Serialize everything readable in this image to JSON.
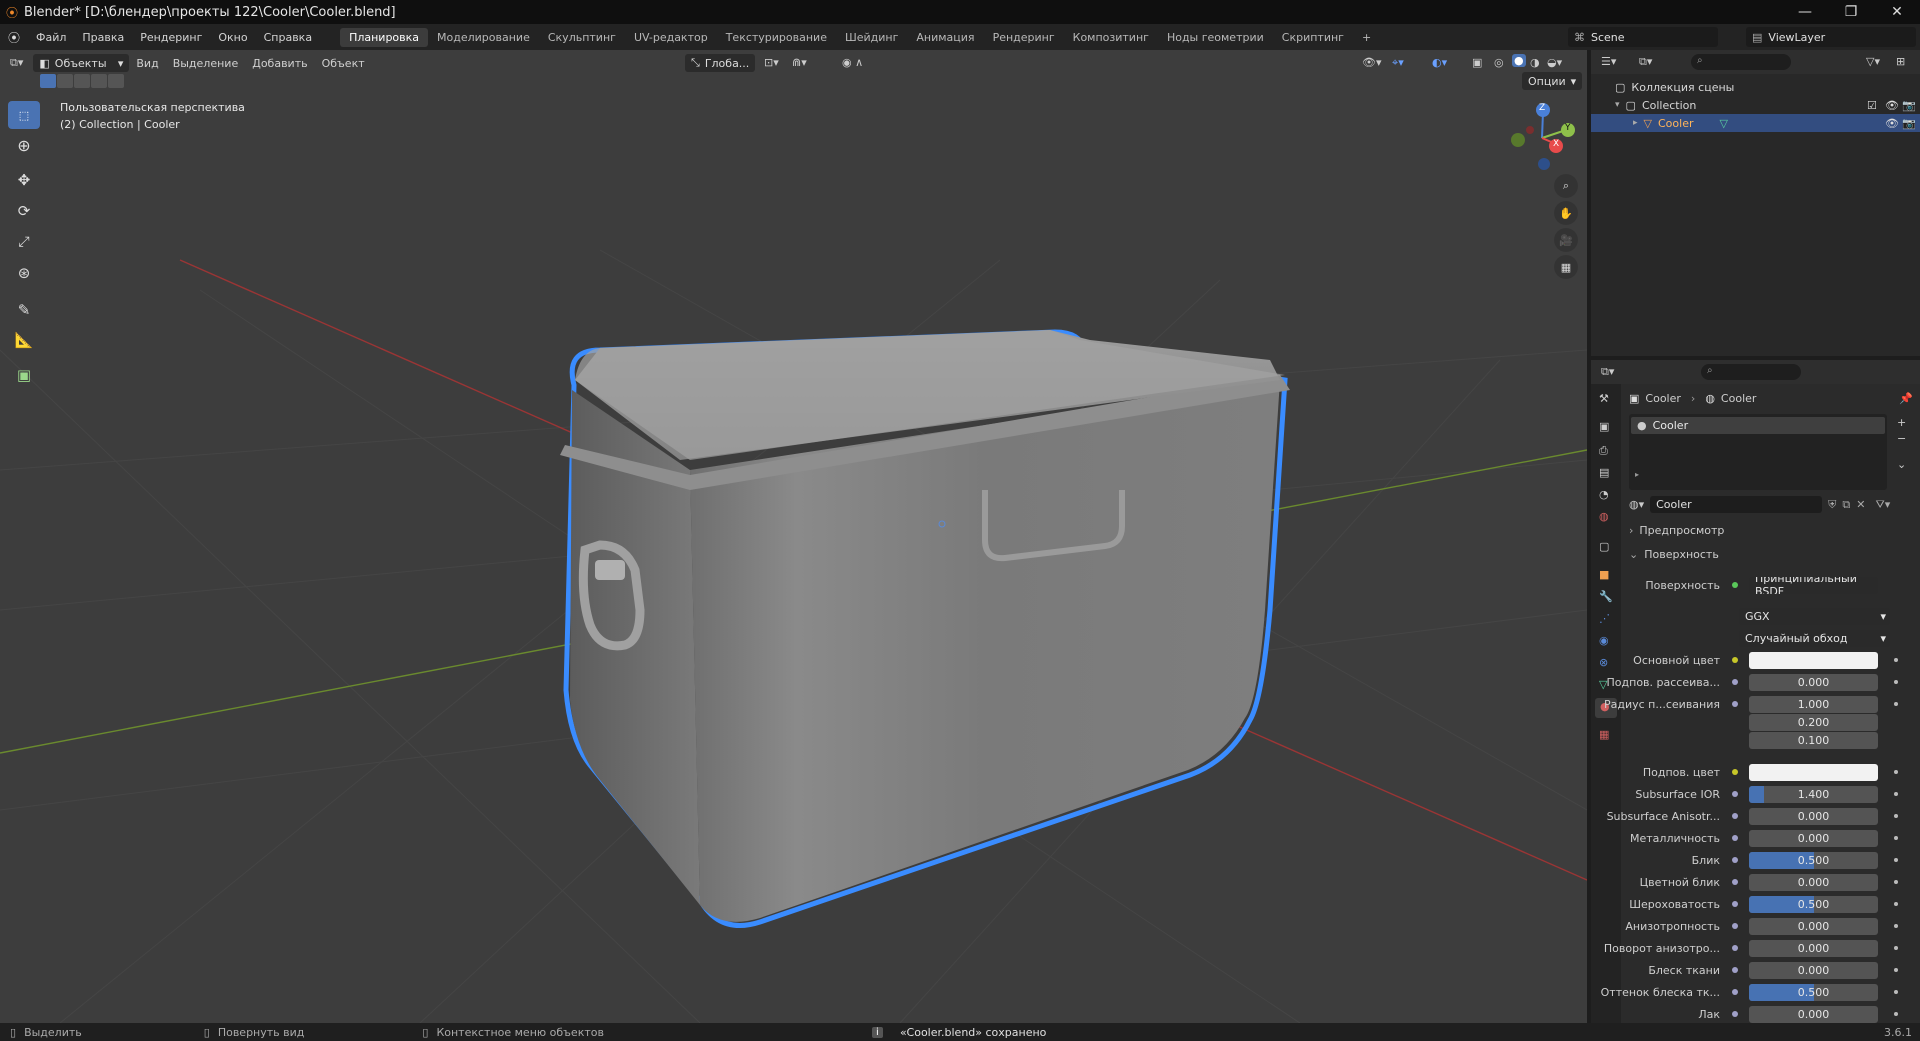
{
  "window": {
    "title": "Blender* [D:\\блендер\\проекты 122\\Cooler\\Cooler.blend]",
    "min": "—",
    "max": "❐",
    "close": "✕"
  },
  "menus": [
    "Файл",
    "Правка",
    "Рендеринг",
    "Окно",
    "Справка"
  ],
  "workspaces": [
    "Планировка",
    "Моделирование",
    "Скульптинг",
    "UV-редактор",
    "Текстурирование",
    "Шейдинг",
    "Анимация",
    "Рендеринг",
    "Композитинг",
    "Ноды геометрии",
    "Скриптинг"
  ],
  "workspace_add": "+",
  "scene": {
    "name": "Scene",
    "view_layer": "ViewLayer"
  },
  "viewport_header": {
    "mode": "Объекты",
    "menus": [
      "Вид",
      "Выделение",
      "Добавить",
      "Объект"
    ],
    "transform": "Глоба...",
    "options": "Опции"
  },
  "viewport": {
    "perspective": "Пользовательская перспектива",
    "collection_info": "(2) Collection | Cooler",
    "axes": {
      "z": "Z",
      "y": "Y",
      "x": "X"
    }
  },
  "outliner": {
    "search_placeholder": "",
    "scene_collection": "Коллекция сцены",
    "collection": "Collection",
    "object": "Cooler"
  },
  "properties": {
    "breadcrumb_object": "Cooler",
    "breadcrumb_material": "Cooler",
    "slot": "Cooler",
    "material_name": "Cooler",
    "panel_preview": "Предпросмотр",
    "panel_surface": "Поверхность",
    "surface_label": "Поверхность",
    "surface_shader": "Принципиальный BSDF",
    "distribution": "GGX",
    "subsurface_method": "Случайный обход",
    "rows": [
      {
        "label": "Основной цвет",
        "type": "color",
        "color": "#f2f2f2",
        "dot": "#c7c729"
      },
      {
        "label": "Подпов. рассеива...",
        "value": "0.000",
        "fill": 0
      },
      {
        "label": "Радиус п...сеивания",
        "value": "1.000",
        "fill": 0,
        "vec": [
          "0.200",
          "0.100"
        ]
      },
      {
        "label": "Подпов. цвет",
        "type": "color",
        "color": "#f2f2f2",
        "dot": "#c7c729"
      },
      {
        "label": "Subsurface IOR",
        "value": "1.400",
        "fill": 0.12
      },
      {
        "label": "Subsurface Anisotr...",
        "value": "0.000",
        "fill": 0
      },
      {
        "label": "Металличность",
        "value": "0.000",
        "fill": 0
      },
      {
        "label": "Блик",
        "value": "0.500",
        "fill": 0.5
      },
      {
        "label": "Цветной блик",
        "value": "0.000",
        "fill": 0
      },
      {
        "label": "Шероховатость",
        "value": "0.500",
        "fill": 0.5
      },
      {
        "label": "Анизотропность",
        "value": "0.000",
        "fill": 0
      },
      {
        "label": "Поворот анизотро...",
        "value": "0.000",
        "fill": 0
      },
      {
        "label": "Блеск ткани",
        "value": "0.000",
        "fill": 0
      },
      {
        "label": "Оттенок блеска тк...",
        "value": "0.500",
        "fill": 0.5
      },
      {
        "label": "Лак",
        "value": "0.000",
        "fill": 0
      }
    ]
  },
  "statusbar": {
    "select": "Выделить",
    "rotate": "Повернуть вид",
    "context": "Контекстное меню объектов",
    "message": "«Cooler.blend» сохранено",
    "version": "3.6.1"
  }
}
